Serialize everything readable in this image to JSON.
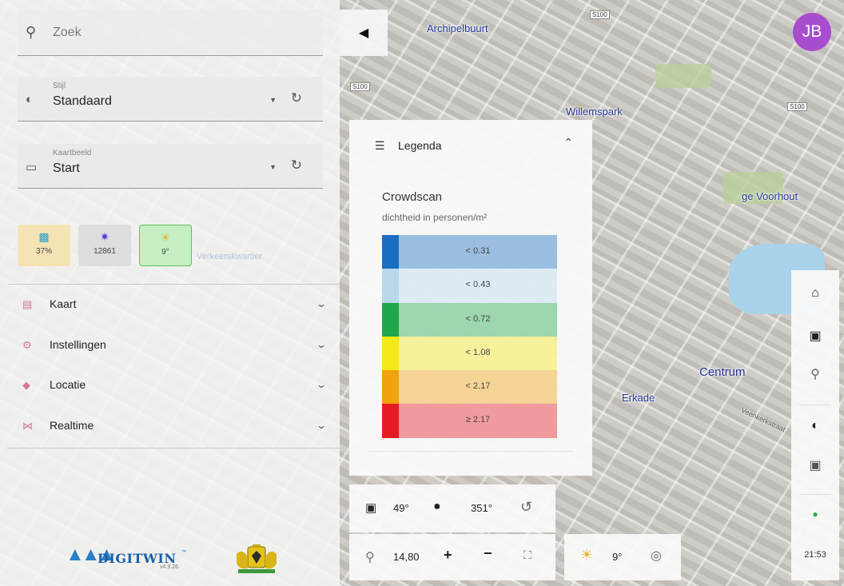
{
  "map": {
    "labels": {
      "archipelbuurt": "Archipelbuurt",
      "willemspark": "Willemspark",
      "centrum": "Centrum",
      "lange_voorhout": "ge Voorhout",
      "erkade": "Erkade",
      "verwelkomst": "Veenkerkstraat"
    },
    "shields": {
      "s1": "S100",
      "s2": "S100",
      "s3": "S100"
    }
  },
  "sidebar": {
    "search": {
      "placeholder": "Zoek"
    },
    "style_select": {
      "label": "Stijl",
      "value": "Standaard"
    },
    "view_select": {
      "label": "Kaartbeeld",
      "value": "Start"
    },
    "tiles": [
      {
        "icon": "cloud-icon",
        "value": "37%",
        "color": "#f4e3b3"
      },
      {
        "icon": "crowd-icon",
        "value": "12861",
        "color": "#dedede"
      },
      {
        "icon": "sun-icon",
        "value": "9°",
        "color": "#c6efc3"
      }
    ],
    "tile_caption": "Verkeerskwartier",
    "sections": [
      {
        "label": "Kaart",
        "icon": "map-icon"
      },
      {
        "label": "Instellingen",
        "icon": "gear-icon"
      },
      {
        "label": "Locatie",
        "icon": "location-icon"
      },
      {
        "label": "Realtime",
        "icon": "realtime-icon"
      }
    ],
    "logo": {
      "name": "DIGITWIN",
      "tm": "™",
      "version": "v4.3.26"
    }
  },
  "avatar": {
    "initials": "JB",
    "color": "#a94dcf"
  },
  "legend": {
    "header": "Legenda",
    "title": "Crowdscan",
    "unit": "dichtheid in personen/m²",
    "items": [
      {
        "label": "< 0.31",
        "color": "#1a6ec2"
      },
      {
        "label": "< 0.43",
        "color": "#b9d8ec"
      },
      {
        "label": "< 0.72",
        "color": "#22a64a"
      },
      {
        "label": "< 1.08",
        "color": "#f3e81a"
      },
      {
        "label": "< 2.17",
        "color": "#f0a20f"
      },
      {
        "label": "≥ 2.17",
        "color": "#e51b23"
      }
    ]
  },
  "camera": {
    "pitch": "49°",
    "heading": "351°"
  },
  "zoom": {
    "level": "14,80"
  },
  "weather": {
    "temp": "9°"
  },
  "time": "21:53"
}
